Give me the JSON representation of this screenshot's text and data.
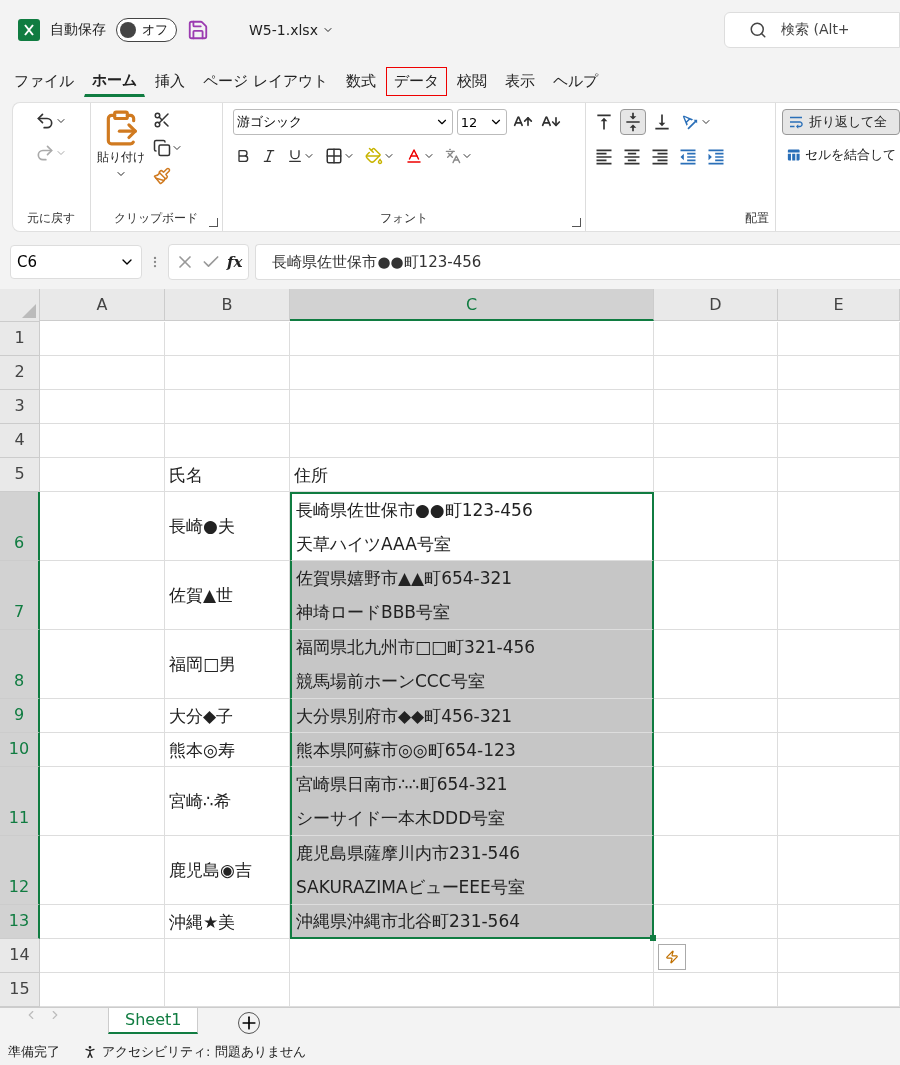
{
  "title_bar": {
    "autosave_label": "自動保存",
    "autosave_toggle": {
      "label": "オフ",
      "on": false
    },
    "filename": "W5-1.xlsx",
    "search": {
      "placeholder": "検索 (Alt+"
    }
  },
  "tabs": [
    {
      "label": "ファイル",
      "selected": false,
      "highlighted": false
    },
    {
      "label": "ホーム",
      "selected": true,
      "highlighted": false
    },
    {
      "label": "挿入",
      "selected": false,
      "highlighted": false
    },
    {
      "label": "ページ レイアウト",
      "selected": false,
      "highlighted": false
    },
    {
      "label": "数式",
      "selected": false,
      "highlighted": false
    },
    {
      "label": "データ",
      "selected": false,
      "highlighted": true
    },
    {
      "label": "校閲",
      "selected": false,
      "highlighted": false
    },
    {
      "label": "表示",
      "selected": false,
      "highlighted": false
    },
    {
      "label": "ヘルプ",
      "selected": false,
      "highlighted": false
    }
  ],
  "ribbon": {
    "undo_group": "元に戻す",
    "clipboard_group": "クリップボード",
    "paste": "貼り付け",
    "font_group": "フォント",
    "font_name": "游ゴシック",
    "font_size": "12",
    "alignment_group": "配置",
    "wrap_text": "折り返して全",
    "merge": "セルを結合して"
  },
  "formula_bar": {
    "name_box": "C6",
    "function_label": "fx",
    "formula": "長崎県佐世保市●●町123-456"
  },
  "sheet": {
    "columns": [
      {
        "label": "A",
        "selected": false
      },
      {
        "label": "B",
        "selected": false
      },
      {
        "label": "C",
        "selected": true
      },
      {
        "label": "D",
        "selected": false
      },
      {
        "label": "E",
        "selected": false
      }
    ],
    "rows": [
      {
        "number": "1",
        "selected": false
      },
      {
        "number": "2",
        "selected": false
      },
      {
        "number": "3",
        "selected": false
      },
      {
        "number": "4",
        "selected": false
      },
      {
        "number": "5",
        "selected": false,
        "b": "氏名",
        "c": [
          "住所"
        ]
      },
      {
        "number": "6",
        "selected": true,
        "active": true,
        "b": "長崎●夫",
        "c": [
          "長崎県佐世保市●●町123-456",
          "天草ハイツAAA号室"
        ]
      },
      {
        "number": "7",
        "selected": true,
        "b": "佐賀▲世",
        "c": [
          "佐賀県嬉野市▲▲町654-321",
          "神埼ロードBBB号室"
        ]
      },
      {
        "number": "8",
        "selected": true,
        "b": "福岡□男",
        "c": [
          "福岡県北九州市□□町321-456",
          "競馬場前ホーンCCC号室"
        ]
      },
      {
        "number": "9",
        "selected": true,
        "b": "大分◆子",
        "c": [
          "大分県別府市◆◆町456-321"
        ]
      },
      {
        "number": "10",
        "selected": true,
        "b": "熊本◎寿",
        "c": [
          "熊本県阿蘇市◎◎町654-123"
        ]
      },
      {
        "number": "11",
        "selected": true,
        "b": "宮崎∴希",
        "c": [
          "宮崎県日南市∴∴町654-321",
          "シーサイド一本木DDD号室"
        ]
      },
      {
        "number": "12",
        "selected": true,
        "b": "鹿児島◉吉",
        "c": [
          "鹿児島県薩摩川内市231-546",
          "SAKURAZIMAビューEEE号室"
        ]
      },
      {
        "number": "13",
        "selected": true,
        "b": "沖縄★美",
        "c": [
          "沖縄県沖縄市北谷町231-564"
        ]
      },
      {
        "number": "14",
        "selected": false
      },
      {
        "number": "15",
        "selected": false
      }
    ]
  },
  "sheet_tabs": [
    {
      "label": "Sheet1",
      "selected": true
    }
  ],
  "status_bar": {
    "ready": "準備完了",
    "accessibility": "アクセシビリティ: 問題ありません"
  }
}
